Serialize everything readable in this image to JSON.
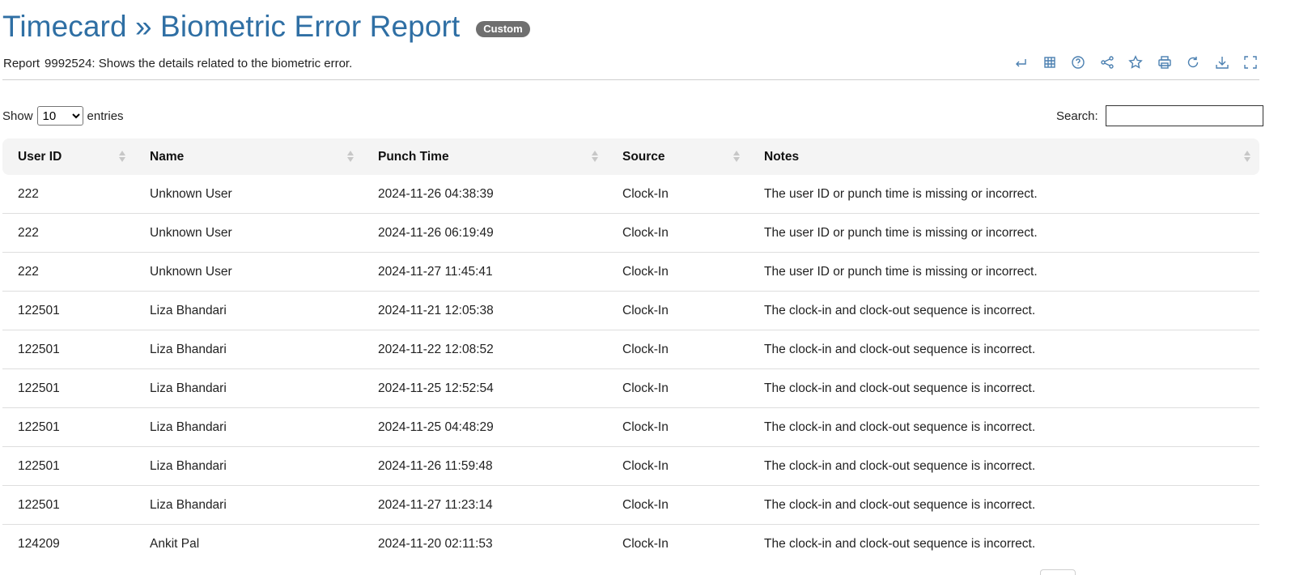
{
  "header": {
    "title": "Timecard » Biometric Error Report",
    "badge": "Custom",
    "report_label": "Report",
    "report_description": "9992524: Shows the details related to the biometric error."
  },
  "toolbar": {
    "icons": [
      "back-arrow-icon",
      "grid-icon",
      "help-icon",
      "share-icon",
      "star-icon",
      "print-icon",
      "refresh-icon",
      "download-icon",
      "fullscreen-icon"
    ]
  },
  "length_control": {
    "show_label": "Show",
    "selected": "10",
    "entries_label": "entries"
  },
  "search": {
    "label": "Search:",
    "value": ""
  },
  "table": {
    "columns": [
      "User ID",
      "Name",
      "Punch Time",
      "Source",
      "Notes"
    ],
    "rows": [
      [
        "222",
        "Unknown User",
        "2024-11-26 04:38:39",
        "Clock-In",
        "The user ID or punch time is missing or incorrect."
      ],
      [
        "222",
        "Unknown User",
        "2024-11-26 06:19:49",
        "Clock-In",
        "The user ID or punch time is missing or incorrect."
      ],
      [
        "222",
        "Unknown User",
        "2024-11-27 11:45:41",
        "Clock-In",
        "The user ID or punch time is missing or incorrect."
      ],
      [
        "122501",
        "Liza Bhandari",
        "2024-11-21 12:05:38",
        "Clock-In",
        "The clock-in and clock-out sequence is incorrect."
      ],
      [
        "122501",
        "Liza Bhandari",
        "2024-11-22 12:08:52",
        "Clock-In",
        "The clock-in and clock-out sequence is incorrect."
      ],
      [
        "122501",
        "Liza Bhandari",
        "2024-11-25 12:52:54",
        "Clock-In",
        "The clock-in and clock-out sequence is incorrect."
      ],
      [
        "122501",
        "Liza Bhandari",
        "2024-11-25 04:48:29",
        "Clock-In",
        "The clock-in and clock-out sequence is incorrect."
      ],
      [
        "122501",
        "Liza Bhandari",
        "2024-11-26 11:59:48",
        "Clock-In",
        "The clock-in and clock-out sequence is incorrect."
      ],
      [
        "122501",
        "Liza Bhandari",
        "2024-11-27 11:23:14",
        "Clock-In",
        "The clock-in and clock-out sequence is incorrect."
      ],
      [
        "124209",
        "Ankit Pal",
        "2024-11-20 02:11:53",
        "Clock-In",
        "The clock-in and clock-out sequence is incorrect."
      ]
    ]
  },
  "colors": {
    "title": "#2f6fa4",
    "badge_bg": "#6f6f6f",
    "icon": "#4a7fb0",
    "header_bg": "#f4f4f4"
  }
}
